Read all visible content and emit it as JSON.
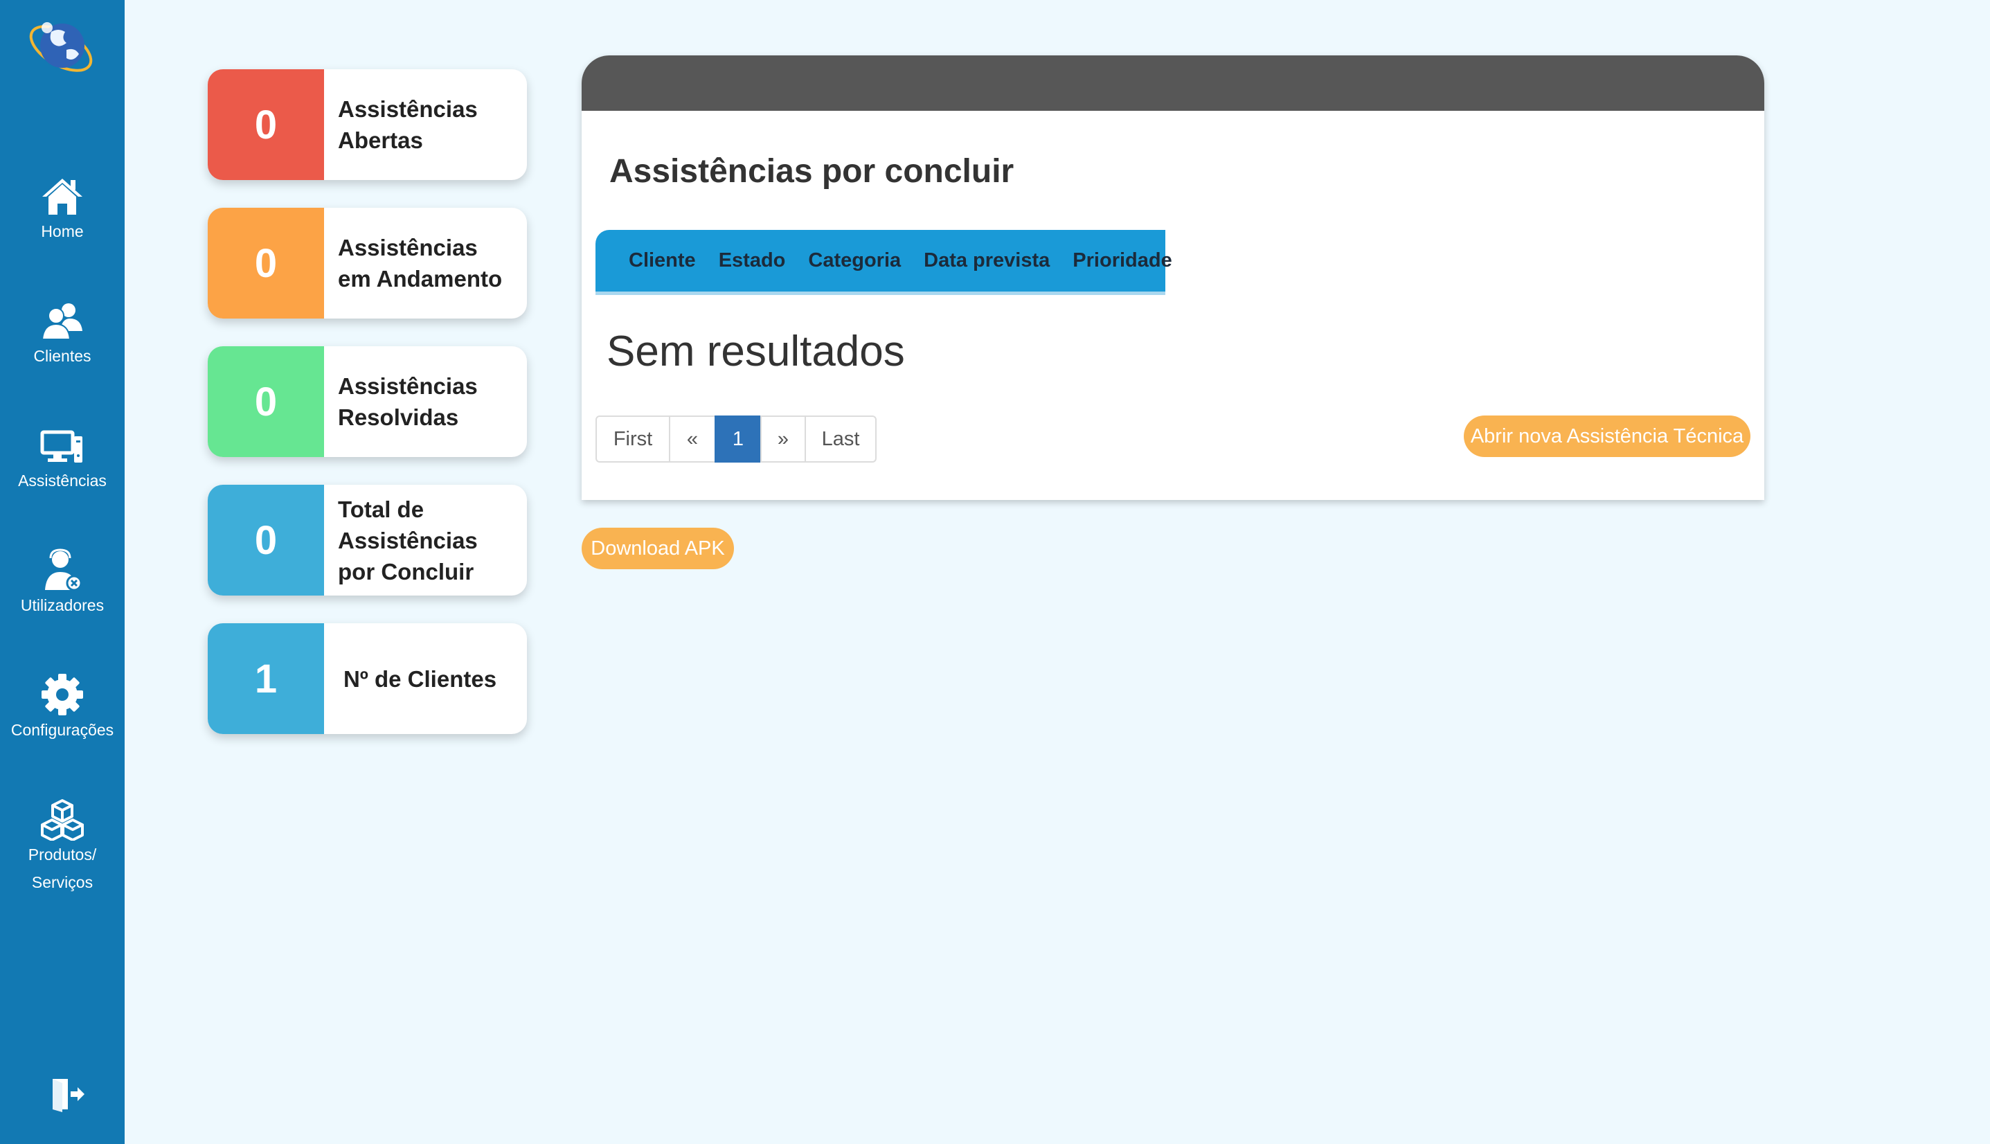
{
  "sidebar": {
    "background_color": "#1279b3",
    "items": [
      {
        "label": "Home",
        "icon": "home-icon"
      },
      {
        "label": "Clientes",
        "icon": "users-icon"
      },
      {
        "label": "Assistências",
        "icon": "desktop-icon"
      },
      {
        "label": "Utilizadores",
        "icon": "user-gear-icon"
      },
      {
        "label": "Configurações",
        "icon": "gear-icon"
      },
      {
        "label_line1": "Produtos/",
        "label_line2": "Serviços",
        "icon": "boxes-icon"
      }
    ],
    "logout_icon": "logout-icon",
    "logo_icon": "globe-logo-icon"
  },
  "stats": [
    {
      "count": "0",
      "label": "Assistências Abertas",
      "color": "#eb5a4a"
    },
    {
      "count": "0",
      "label": "Assistências em Andamento",
      "color": "#fca346"
    },
    {
      "count": "0",
      "label": "Assistências Resolvidas",
      "color": "#66e692"
    },
    {
      "count": "0",
      "label": "Total de Assistências por Concluir",
      "color": "#3eaed9"
    },
    {
      "count": "1",
      "label": "Nº de Clientes",
      "color": "#3eaed9"
    }
  ],
  "panel": {
    "title": "Assistências por concluir",
    "columns": [
      "Cliente",
      "Estado",
      "Categoria",
      "Data prevista",
      "Prioridade"
    ],
    "empty_message": "Sem resultados",
    "pagination": {
      "first": "First",
      "prev": "«",
      "current": "1",
      "next": "»",
      "last": "Last"
    },
    "new_button": "Abrir nova Assistência Técnica"
  },
  "download_button": "Download APK",
  "colors": {
    "header_bar": "#575757",
    "table_head": "#1a9ad7",
    "accent_orange": "#f9b351",
    "page_active": "#2d72b8",
    "background": "#eef9fe"
  }
}
